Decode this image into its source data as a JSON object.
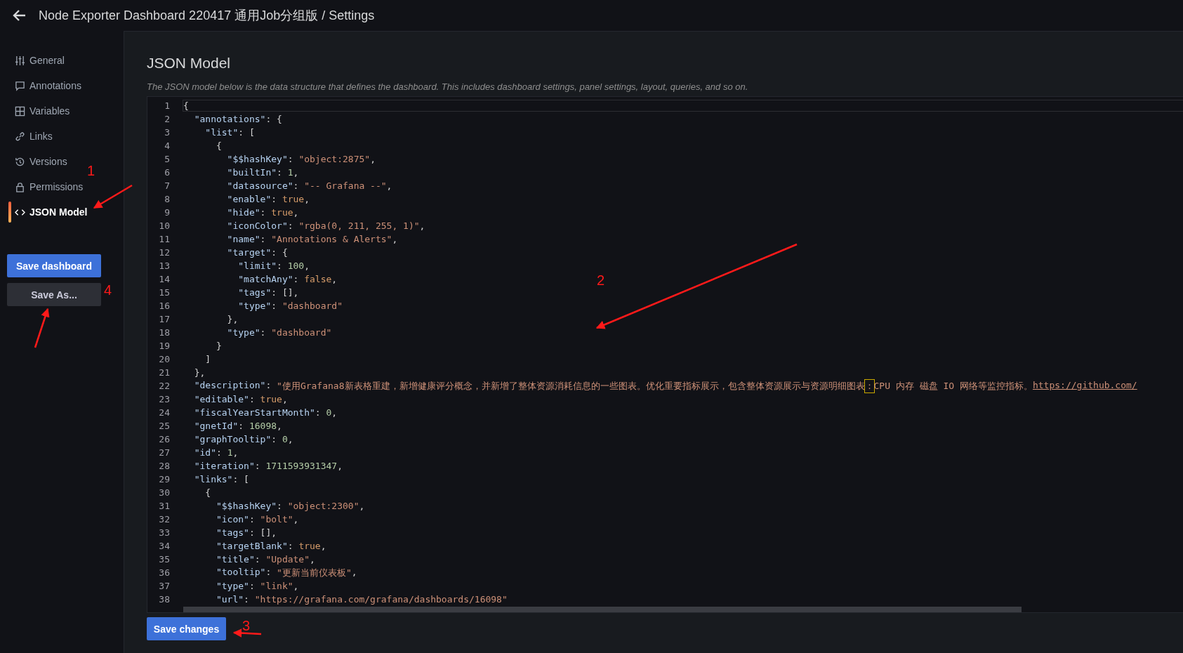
{
  "header": {
    "title": "Node Exporter Dashboard 220417 通用Job分组版 / Settings"
  },
  "sidebar": {
    "items": [
      {
        "label": "General",
        "selected": false
      },
      {
        "label": "Annotations",
        "selected": false
      },
      {
        "label": "Variables",
        "selected": false
      },
      {
        "label": "Links",
        "selected": false
      },
      {
        "label": "Versions",
        "selected": false
      },
      {
        "label": "Permissions",
        "selected": false
      },
      {
        "label": "JSON Model",
        "selected": true
      }
    ],
    "buttons": [
      {
        "label": "Save dashboard",
        "kind": "primary"
      },
      {
        "label": "Save As...",
        "kind": "secondary"
      }
    ]
  },
  "main": {
    "heading": "JSON Model",
    "description": "The JSON model below is the data structure that defines the dashboard. This includes dashboard settings, panel settings, layout, queries, and so on.",
    "editor": {
      "lines": [
        {
          "n": "1",
          "t": [
            {
              "kind": "p",
              "text": "{"
            }
          ]
        },
        {
          "n": "2",
          "t": [
            {
              "kind": "key",
              "text": "  \"annotations\""
            },
            {
              "kind": "p",
              "text": ": {"
            }
          ]
        },
        {
          "n": "3",
          "t": [
            {
              "kind": "key",
              "text": "    \"list\""
            },
            {
              "kind": "p",
              "text": ": ["
            }
          ]
        },
        {
          "n": "4",
          "t": [
            {
              "kind": "p",
              "text": "      {"
            }
          ]
        },
        {
          "n": "5",
          "t": [
            {
              "kind": "key",
              "text": "        \"$$hashKey\""
            },
            {
              "kind": "p",
              "text": ": "
            },
            {
              "kind": "str",
              "text": "\"object:2875\""
            },
            {
              "kind": "p",
              "text": ","
            }
          ]
        },
        {
          "n": "6",
          "t": [
            {
              "kind": "key",
              "text": "        \"builtIn\""
            },
            {
              "kind": "p",
              "text": ": "
            },
            {
              "kind": "num",
              "text": "1"
            },
            {
              "kind": "p",
              "text": ","
            }
          ]
        },
        {
          "n": "7",
          "t": [
            {
              "kind": "key",
              "text": "        \"datasource\""
            },
            {
              "kind": "p",
              "text": ": "
            },
            {
              "kind": "str",
              "text": "\"-- Grafana --\""
            },
            {
              "kind": "p",
              "text": ","
            }
          ]
        },
        {
          "n": "8",
          "t": [
            {
              "kind": "key",
              "text": "        \"enable\""
            },
            {
              "kind": "p",
              "text": ": "
            },
            {
              "kind": "bool",
              "text": "true"
            },
            {
              "kind": "p",
              "text": ","
            }
          ]
        },
        {
          "n": "9",
          "t": [
            {
              "kind": "key",
              "text": "        \"hide\""
            },
            {
              "kind": "p",
              "text": ": "
            },
            {
              "kind": "bool",
              "text": "true"
            },
            {
              "kind": "p",
              "text": ","
            }
          ]
        },
        {
          "n": "10",
          "t": [
            {
              "kind": "key",
              "text": "        \"iconColor\""
            },
            {
              "kind": "p",
              "text": ": "
            },
            {
              "kind": "str",
              "text": "\"rgba(0, 211, 255, 1)\""
            },
            {
              "kind": "p",
              "text": ","
            }
          ]
        },
        {
          "n": "11",
          "t": [
            {
              "kind": "key",
              "text": "        \"name\""
            },
            {
              "kind": "p",
              "text": ": "
            },
            {
              "kind": "str",
              "text": "\"Annotations & Alerts\""
            },
            {
              "kind": "p",
              "text": ","
            }
          ]
        },
        {
          "n": "12",
          "t": [
            {
              "kind": "key",
              "text": "        \"target\""
            },
            {
              "kind": "p",
              "text": ": {"
            }
          ]
        },
        {
          "n": "13",
          "t": [
            {
              "kind": "key",
              "text": "          \"limit\""
            },
            {
              "kind": "p",
              "text": ": "
            },
            {
              "kind": "num",
              "text": "100"
            },
            {
              "kind": "p",
              "text": ","
            }
          ]
        },
        {
          "n": "14",
          "t": [
            {
              "kind": "key",
              "text": "          \"matchAny\""
            },
            {
              "kind": "p",
              "text": ": "
            },
            {
              "kind": "bool",
              "text": "false"
            },
            {
              "kind": "p",
              "text": ","
            }
          ]
        },
        {
          "n": "15",
          "t": [
            {
              "kind": "key",
              "text": "          \"tags\""
            },
            {
              "kind": "p",
              "text": ": [],"
            }
          ]
        },
        {
          "n": "16",
          "t": [
            {
              "kind": "key",
              "text": "          \"type\""
            },
            {
              "kind": "p",
              "text": ": "
            },
            {
              "kind": "str",
              "text": "\"dashboard\""
            }
          ]
        },
        {
          "n": "17",
          "t": [
            {
              "kind": "p",
              "text": "        },"
            }
          ]
        },
        {
          "n": "18",
          "t": [
            {
              "kind": "key",
              "text": "        \"type\""
            },
            {
              "kind": "p",
              "text": ": "
            },
            {
              "kind": "str",
              "text": "\"dashboard\""
            }
          ]
        },
        {
          "n": "19",
          "t": [
            {
              "kind": "p",
              "text": "      }"
            }
          ]
        },
        {
          "n": "20",
          "t": [
            {
              "kind": "p",
              "text": "    ]"
            }
          ]
        },
        {
          "n": "21",
          "t": [
            {
              "kind": "p",
              "text": "  },"
            }
          ]
        },
        {
          "n": "22",
          "t": [
            {
              "kind": "key",
              "text": "  \"description\""
            },
            {
              "kind": "p",
              "text": ": "
            },
            {
              "kind": "str",
              "text": "\"使用Grafana8新表格重建，新增健康评分概念，并新增了整体资源消耗信息的一些图表。优化重要指标展示，包含整体资源展示与资源明细图表"
            },
            {
              "kind": "hl",
              "text": "："
            },
            {
              "kind": "str",
              "text": "CPU 内存 磁盘 IO 网络等监控指标。"
            },
            {
              "kind": "link",
              "text": "https://github.com/"
            }
          ]
        },
        {
          "n": "23",
          "t": [
            {
              "kind": "key",
              "text": "  \"editable\""
            },
            {
              "kind": "p",
              "text": ": "
            },
            {
              "kind": "bool",
              "text": "true"
            },
            {
              "kind": "p",
              "text": ","
            }
          ]
        },
        {
          "n": "24",
          "t": [
            {
              "kind": "key",
              "text": "  \"fiscalYearStartMonth\""
            },
            {
              "kind": "p",
              "text": ": "
            },
            {
              "kind": "num",
              "text": "0"
            },
            {
              "kind": "p",
              "text": ","
            }
          ]
        },
        {
          "n": "25",
          "t": [
            {
              "kind": "key",
              "text": "  \"gnetId\""
            },
            {
              "kind": "p",
              "text": ": "
            },
            {
              "kind": "num",
              "text": "16098"
            },
            {
              "kind": "p",
              "text": ","
            }
          ]
        },
        {
          "n": "26",
          "t": [
            {
              "kind": "key",
              "text": "  \"graphTooltip\""
            },
            {
              "kind": "p",
              "text": ": "
            },
            {
              "kind": "num",
              "text": "0"
            },
            {
              "kind": "p",
              "text": ","
            }
          ]
        },
        {
          "n": "27",
          "t": [
            {
              "kind": "key",
              "text": "  \"id\""
            },
            {
              "kind": "p",
              "text": ": "
            },
            {
              "kind": "num",
              "text": "1"
            },
            {
              "kind": "p",
              "text": ","
            }
          ]
        },
        {
          "n": "28",
          "t": [
            {
              "kind": "key",
              "text": "  \"iteration\""
            },
            {
              "kind": "p",
              "text": ": "
            },
            {
              "kind": "num",
              "text": "1711593931347"
            },
            {
              "kind": "p",
              "text": ","
            }
          ]
        },
        {
          "n": "29",
          "t": [
            {
              "kind": "key",
              "text": "  \"links\""
            },
            {
              "kind": "p",
              "text": ": ["
            }
          ]
        },
        {
          "n": "30",
          "t": [
            {
              "kind": "p",
              "text": "    {"
            }
          ]
        },
        {
          "n": "31",
          "t": [
            {
              "kind": "key",
              "text": "      \"$$hashKey\""
            },
            {
              "kind": "p",
              "text": ": "
            },
            {
              "kind": "str",
              "text": "\"object:2300\""
            },
            {
              "kind": "p",
              "text": ","
            }
          ]
        },
        {
          "n": "32",
          "t": [
            {
              "kind": "key",
              "text": "      \"icon\""
            },
            {
              "kind": "p",
              "text": ": "
            },
            {
              "kind": "str",
              "text": "\"bolt\""
            },
            {
              "kind": "p",
              "text": ","
            }
          ]
        },
        {
          "n": "33",
          "t": [
            {
              "kind": "key",
              "text": "      \"tags\""
            },
            {
              "kind": "p",
              "text": ": [],"
            }
          ]
        },
        {
          "n": "34",
          "t": [
            {
              "kind": "key",
              "text": "      \"targetBlank\""
            },
            {
              "kind": "p",
              "text": ": "
            },
            {
              "kind": "bool",
              "text": "true"
            },
            {
              "kind": "p",
              "text": ","
            }
          ]
        },
        {
          "n": "35",
          "t": [
            {
              "kind": "key",
              "text": "      \"title\""
            },
            {
              "kind": "p",
              "text": ": "
            },
            {
              "kind": "str",
              "text": "\"Update\""
            },
            {
              "kind": "p",
              "text": ","
            }
          ]
        },
        {
          "n": "36",
          "t": [
            {
              "kind": "key",
              "text": "      \"tooltip\""
            },
            {
              "kind": "p",
              "text": ": "
            },
            {
              "kind": "str",
              "text": "\"更新当前仪表板\""
            },
            {
              "kind": "p",
              "text": ","
            }
          ]
        },
        {
          "n": "37",
          "t": [
            {
              "kind": "key",
              "text": "      \"type\""
            },
            {
              "kind": "p",
              "text": ": "
            },
            {
              "kind": "str",
              "text": "\"link\""
            },
            {
              "kind": "p",
              "text": ","
            }
          ]
        },
        {
          "n": "38",
          "t": [
            {
              "kind": "key",
              "text": "      \"url\""
            },
            {
              "kind": "p",
              "text": ": "
            },
            {
              "kind": "str",
              "text": "\"https://grafana.com/grafana/dashboards/16098\""
            }
          ]
        }
      ]
    },
    "save_button": "Save changes"
  },
  "markup": [
    {
      "label": "1"
    },
    {
      "label": "2"
    },
    {
      "label": "3"
    },
    {
      "label": "4"
    }
  ]
}
